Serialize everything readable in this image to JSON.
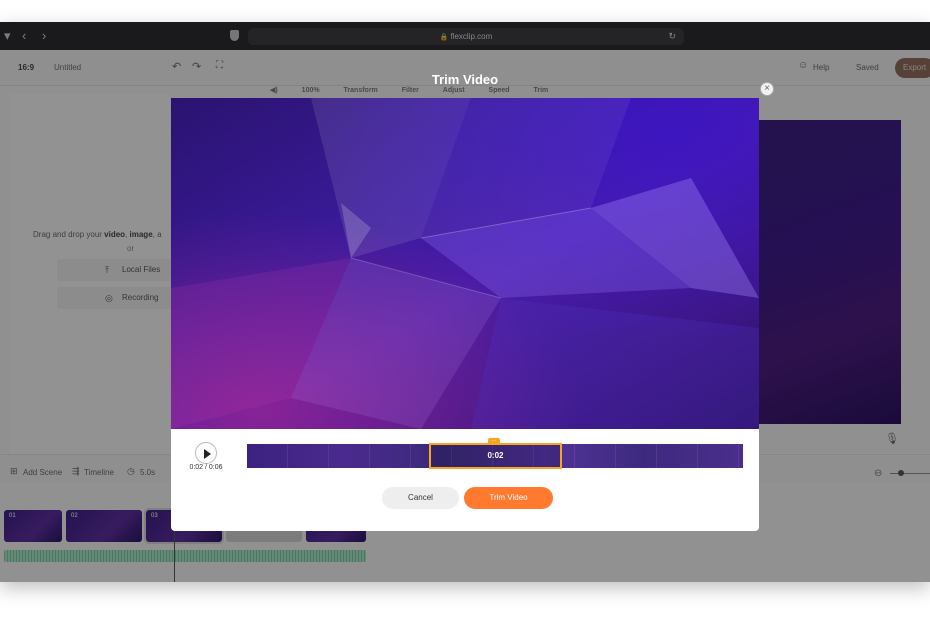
{
  "browser": {
    "url": "flexclip.com",
    "back_icon": "chevron-left-icon",
    "forward_icon": "chevron-right-icon",
    "lock_icon": "lock-icon",
    "reload_icon": "reload-icon"
  },
  "app_toolbar": {
    "aspect": "16:9",
    "project_name": "Untitled",
    "help_label": "Help",
    "saved_label": "Saved",
    "export_label": "Export"
  },
  "edit_toolbar": {
    "zoom": "100%",
    "items": [
      "Transform",
      "Filter",
      "Adjust",
      "Speed",
      "Trim"
    ]
  },
  "left_panel": {
    "drag_prefix": "Drag and drop your ",
    "drag_video": "video",
    "drag_sep1": ", ",
    "drag_image": "image",
    "drag_sep2": ", a",
    "or_label": "or",
    "local_files_label": "Local Files",
    "recording_label": "Recording"
  },
  "bottom_bar": {
    "add_scene_label": "Add Scene",
    "timeline_label": "Timeline",
    "duration_label": "5.0s"
  },
  "scenes": [
    {
      "label": "01"
    },
    {
      "label": "02"
    },
    {
      "label": "03"
    }
  ],
  "modal": {
    "title": "Trim Video",
    "time_readout": "0:02 / 0:06",
    "selection_label": "0:02",
    "cancel_label": "Cancel",
    "trim_label": "Trim Video",
    "colors": {
      "accent": "#ff7a2e",
      "selection": "#f6a623"
    }
  }
}
